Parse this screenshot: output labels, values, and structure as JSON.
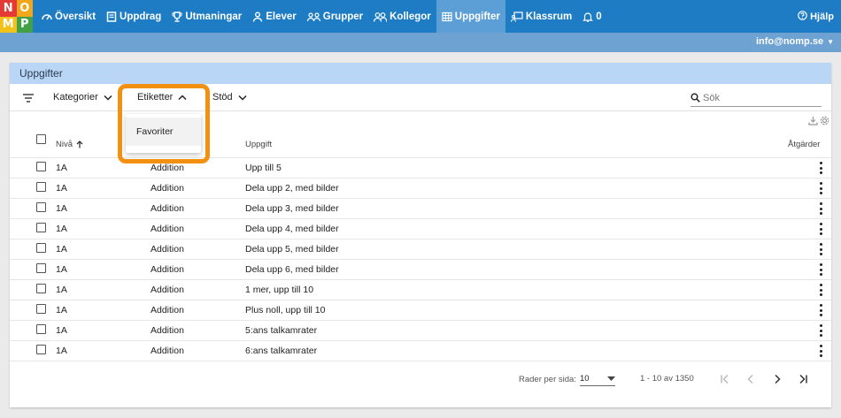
{
  "logo": {
    "letters": [
      "N",
      "O",
      "M",
      "P"
    ],
    "colors": [
      "#e53935",
      "#f2a71b",
      "#f2c21b",
      "#43a047"
    ]
  },
  "nav": {
    "items": [
      {
        "label": "Översikt",
        "icon": "dashboard-icon"
      },
      {
        "label": "Uppdrag",
        "icon": "assignment-icon"
      },
      {
        "label": "Utmaningar",
        "icon": "trophy-icon"
      },
      {
        "label": "Elever",
        "icon": "person-icon"
      },
      {
        "label": "Grupper",
        "icon": "group-icon"
      },
      {
        "label": "Kollegor",
        "icon": "colleagues-icon"
      },
      {
        "label": "Uppgifter",
        "icon": "grid-icon",
        "active": true
      },
      {
        "label": "Klassrum",
        "icon": "classroom-icon"
      },
      {
        "label": "0",
        "icon": "bell-icon"
      }
    ],
    "help_label": "Hjälp"
  },
  "user": {
    "email": "info@nomp.se"
  },
  "colors": {
    "nav_bg": "#1d7cc4",
    "nav_active": "#5b9fd6",
    "subbar": "#6da2d3",
    "card_head": "#b9d6f7",
    "highlight": "#f29111"
  },
  "card": {
    "title": "Uppgifter"
  },
  "toolbar": {
    "kategorier_label": "Kategorier",
    "etiketter_label": "Etiketter",
    "stod_label": "Stöd",
    "search_placeholder": "Sök"
  },
  "dropdown": {
    "options": [
      "Favoriter"
    ]
  },
  "table": {
    "columns": {
      "level": "Nivå",
      "task": "Uppgift",
      "actions": "Åtgärder"
    },
    "rows": [
      {
        "level": "1A",
        "category": "Addition",
        "task": "Upp till 5"
      },
      {
        "level": "1A",
        "category": "Addition",
        "task": "Dela upp 2, med bilder"
      },
      {
        "level": "1A",
        "category": "Addition",
        "task": "Dela upp 3, med bilder"
      },
      {
        "level": "1A",
        "category": "Addition",
        "task": "Dela upp 4, med bilder"
      },
      {
        "level": "1A",
        "category": "Addition",
        "task": "Dela upp 5, med bilder"
      },
      {
        "level": "1A",
        "category": "Addition",
        "task": "Dela upp 6, med bilder"
      },
      {
        "level": "1A",
        "category": "Addition",
        "task": "1 mer, upp till 10"
      },
      {
        "level": "1A",
        "category": "Addition",
        "task": "Plus noll, upp till 10"
      },
      {
        "level": "1A",
        "category": "Addition",
        "task": "5:ans talkamrater"
      },
      {
        "level": "1A",
        "category": "Addition",
        "task": "6:ans talkamrater"
      }
    ]
  },
  "pagination": {
    "rows_per_page_label": "Rader per sida:",
    "rows_per_page": "10",
    "range": "1 - 10 av 1350"
  }
}
